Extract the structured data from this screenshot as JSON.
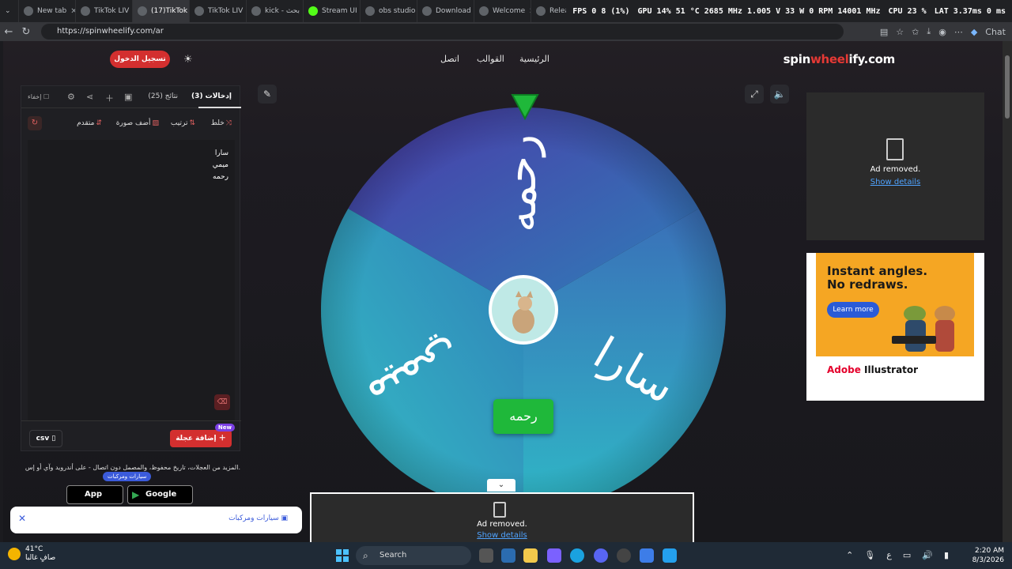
{
  "browser": {
    "tabs": [
      {
        "label": "New tab"
      },
      {
        "label": "TikTok LIV"
      },
      {
        "label": "(17)TikTok"
      },
      {
        "label": "TikTok LIV"
      },
      {
        "label": "kick - بحث"
      },
      {
        "label": "Stream UI"
      },
      {
        "label": "obs studio"
      },
      {
        "label": "Download"
      },
      {
        "label": "Welcome"
      },
      {
        "label": "Release C"
      }
    ],
    "stats": {
      "fps": "FPS   0   8 (1%)",
      "gpu": "GPU 14%  51 °C  2685 MHz  1.005 V  33 W  0 RPM  14001 MHz",
      "cpu": "CPU 23 %",
      "lat": "LAT 3.37ms  0 ms"
    },
    "url": "https://spinwheelify.com/ar",
    "chat_label": "Chat"
  },
  "site": {
    "logo_a": "spin",
    "logo_b": "wheel",
    "logo_c": "ify.com",
    "nav": {
      "home": "الرئيسية",
      "templates": "القوالب",
      "contact": "اتصل"
    },
    "login": "تسجيل الدخول"
  },
  "panel": {
    "tab_entries": "إدخالات (3)",
    "tab_results": "نتائج (25)",
    "hide_label": "إخفاء",
    "tools": {
      "shuffle": "خلط",
      "sort": "ترتيب",
      "add_image": "أضف صورة",
      "advanced": "متقدم"
    },
    "entries": [
      "سارا",
      "ميمي",
      "رحمه"
    ],
    "add_wheel": "إضافة عجلة",
    "new_badge": "New",
    "csv": "csv"
  },
  "promo": {
    "text": "المزيد من العجلات، تاريخ محفوظ، والمصمل دون اتصال - على أندرويد وآي أو إس.",
    "badge": "سيارات ومركبات",
    "app_store": "App Store",
    "google_play": "Google Play"
  },
  "toast": {
    "text": "سيارات ومركبات"
  },
  "wheel": {
    "segments": [
      {
        "label": "رحمه",
        "color_a": "#4b3aa8",
        "color_b": "#2f7fb8"
      },
      {
        "label": "سارا",
        "color_a": "#3a6fb8",
        "color_b": "#2fb8c6"
      },
      {
        "label": "ميمي",
        "color_a": "#35a6c0",
        "color_b": "#2f7fb8"
      }
    ],
    "winner": "رحمه",
    "pointer_color": "#1fb83a"
  },
  "ads": {
    "removed": "Ad removed.",
    "details": "Show details",
    "adobe_headline_1": "Instant angles.",
    "adobe_headline_2": "No redraws.",
    "adobe_button": "Learn more",
    "adobe_brand_a": "Adobe",
    "adobe_brand_b": "Illustrator"
  },
  "taskbar": {
    "weather_temp": "41°C",
    "weather_desc": "صافٍ غالبا",
    "search": "Search",
    "time": "2:20 AM",
    "date": "8/3/2026"
  }
}
